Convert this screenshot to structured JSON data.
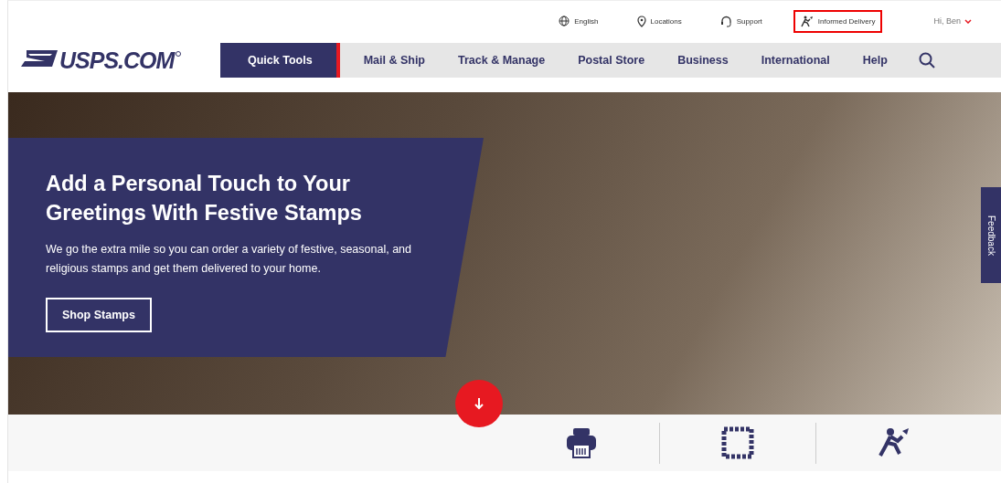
{
  "utility_bar": [
    {
      "label": "English",
      "kind": "globe",
      "highlighted": false
    },
    {
      "label": "Locations",
      "kind": "pin",
      "highlighted": false
    },
    {
      "label": "Support",
      "kind": "headset",
      "highlighted": false
    },
    {
      "label": "Informed Delivery",
      "kind": "carrier",
      "highlighted": true
    }
  ],
  "account": {
    "label": "Hi, Ben"
  },
  "logo": {
    "text": "USPS.COM"
  },
  "nav": [
    {
      "label": "Quick Tools",
      "selected": true
    },
    {
      "label": "Mail & Ship",
      "selected": false
    },
    {
      "label": "Track & Manage",
      "selected": false
    },
    {
      "label": "Postal Store",
      "selected": false
    },
    {
      "label": "Business",
      "selected": false
    },
    {
      "label": "International",
      "selected": false
    },
    {
      "label": "Help",
      "selected": false
    }
  ],
  "hero": {
    "title": "Add a Personal Touch to Your Greetings With Festive Stamps",
    "text": "We go the extra mile so you can order a variety of festive, seasonal, and religious stamps and get them delivered to your home.",
    "button": "Shop Stamps"
  },
  "feedback": {
    "label": "Feedback"
  },
  "quick_icons": [
    {
      "kind": "printer"
    },
    {
      "kind": "stamp"
    },
    {
      "kind": "carrier"
    }
  ]
}
